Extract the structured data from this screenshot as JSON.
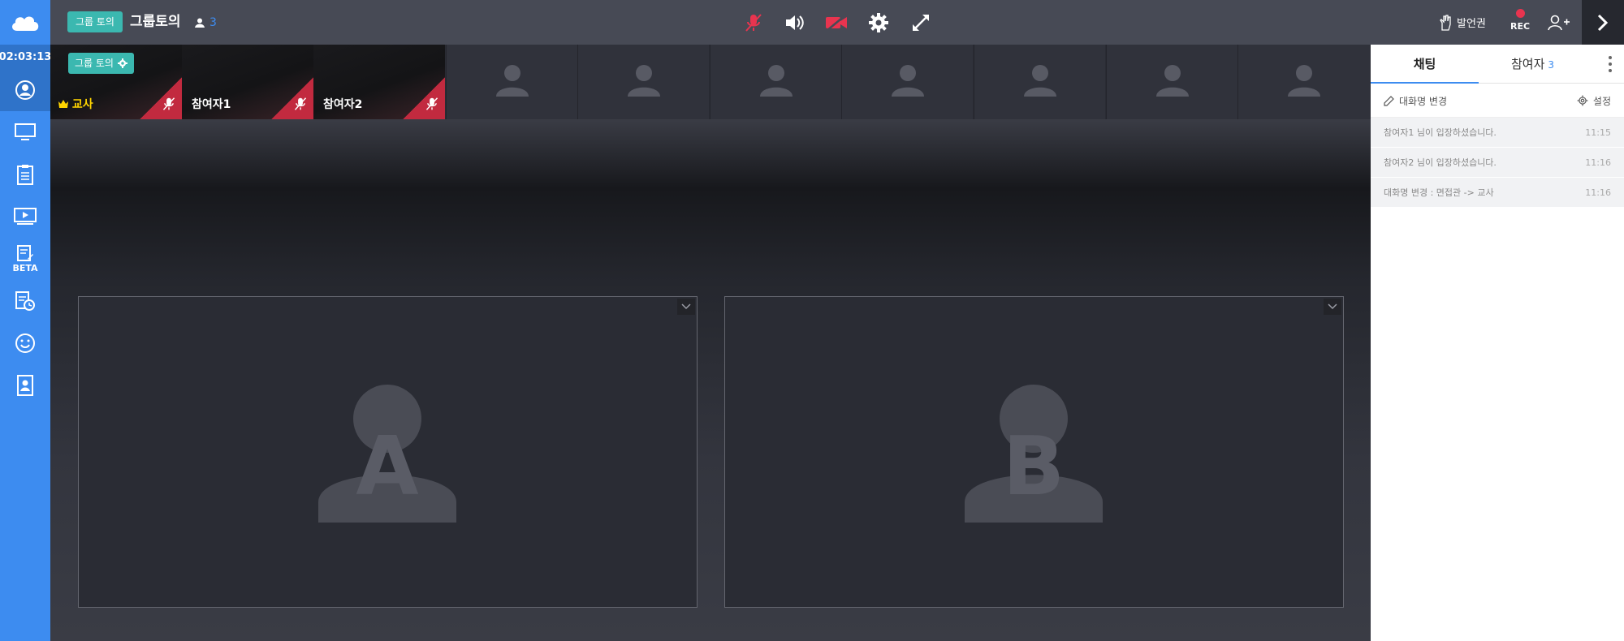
{
  "sidebar": {
    "timer": "02:03:13",
    "items": [
      {
        "icon": "user-circle-icon"
      },
      {
        "icon": "monitor-icon"
      },
      {
        "icon": "clipboard-icon"
      },
      {
        "icon": "play-screen-icon"
      },
      {
        "icon": "edit-doc-icon",
        "badge": "BETA"
      },
      {
        "icon": "doc-clock-icon"
      },
      {
        "icon": "smile-icon"
      },
      {
        "icon": "contact-book-icon"
      }
    ]
  },
  "topbar": {
    "mode_badge": "그룹 토의",
    "room_title": "그룹토의",
    "participant_count": "3",
    "speak_label": "발언권",
    "rec_label": "REC"
  },
  "strip": {
    "gear_badge": "그룹 토의",
    "participants": [
      {
        "name": "교사",
        "host": true
      },
      {
        "name": "참여자1",
        "host": false
      },
      {
        "name": "참여자2",
        "host": false
      }
    ],
    "empty_slots": 7
  },
  "stage": {
    "boxes": [
      {
        "letter": "A"
      },
      {
        "letter": "B"
      }
    ]
  },
  "panel": {
    "tab_chat": "채팅",
    "tab_participants": "참여자",
    "participants_count": "3",
    "rename_label": "대화명 변경",
    "settings_label": "설정",
    "messages": [
      {
        "text": "참여자1 님이 입장하셨습니다.",
        "time": "11:15"
      },
      {
        "text": "참여자2 님이 입장하셨습니다.",
        "time": "11:16"
      },
      {
        "text": "대화명 변경 : 면접관 -> 교사",
        "time": "11:16"
      }
    ]
  },
  "colors": {
    "accent_blue": "#3d8cf0",
    "teal": "#3bb8b0",
    "alert_red": "#e8344f",
    "host_gold": "#ffd400"
  }
}
